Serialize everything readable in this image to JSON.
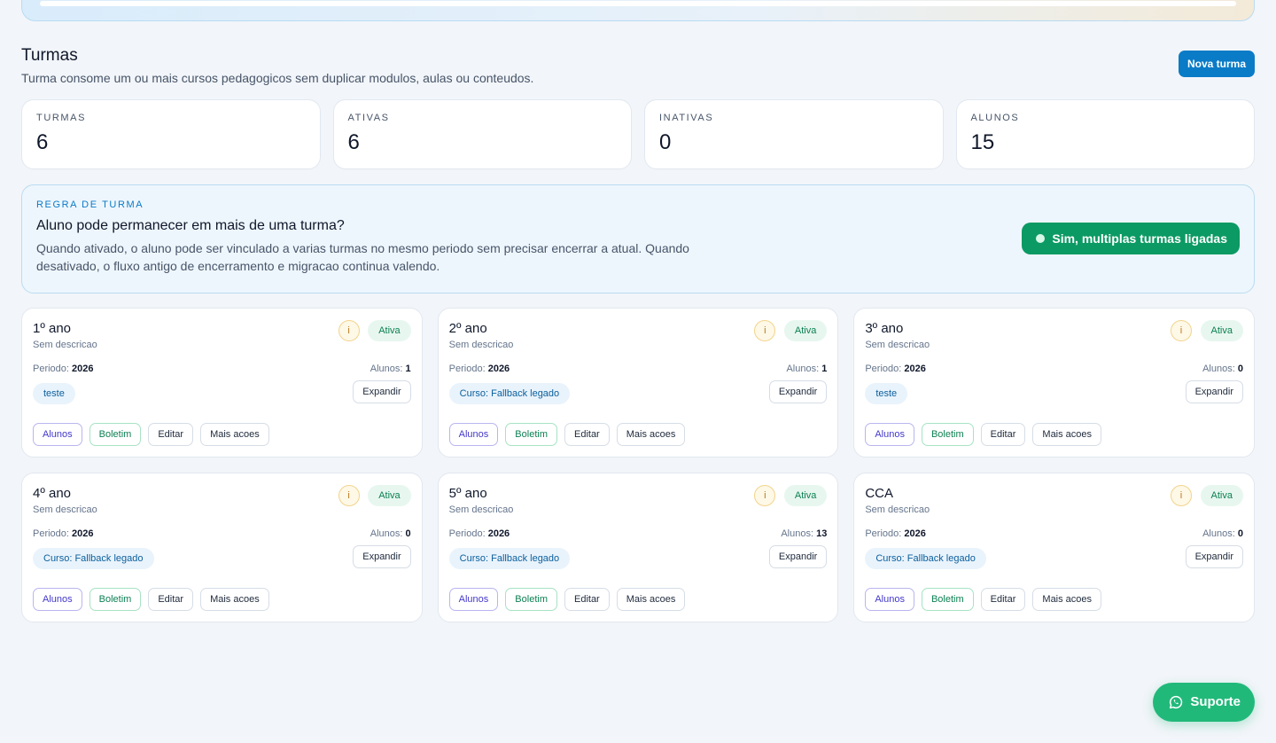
{
  "header": {
    "title": "Turmas",
    "subtitle": "Turma consome um ou mais cursos pedagogicos sem duplicar modulos, aulas ou conteudos.",
    "new_button": "Nova turma"
  },
  "stats": [
    {
      "label": "TURMAS",
      "value": "6"
    },
    {
      "label": "ATIVAS",
      "value": "6"
    },
    {
      "label": "INATIVAS",
      "value": "0"
    },
    {
      "label": "ALUNOS",
      "value": "15"
    }
  ],
  "rule": {
    "eyebrow": "REGRA DE TURMA",
    "title": "Aluno pode permanecer em mais de uma turma?",
    "description": "Quando ativado, o aluno pode ser vinculado a varias turmas no mesmo periodo sem precisar encerrar a atual. Quando desativado, o fluxo antigo de encerramento e migracao continua valendo.",
    "toggle_label": "Sim, multiplas turmas ligadas"
  },
  "labels": {
    "period": "Periodo:",
    "students": "Alunos:",
    "expand": "Expandir",
    "info": "i",
    "actions": {
      "alunos": "Alunos",
      "boletim": "Boletim",
      "editar": "Editar",
      "mais": "Mais acoes"
    }
  },
  "cards": [
    {
      "name": "1º ano",
      "description": "Sem descricao",
      "status": "Ativa",
      "period": "2026",
      "students": "1",
      "course": "teste"
    },
    {
      "name": "2º ano",
      "description": "Sem descricao",
      "status": "Ativa",
      "period": "2026",
      "students": "1",
      "course": "Curso: Fallback legado"
    },
    {
      "name": "3º ano",
      "description": "Sem descricao",
      "status": "Ativa",
      "period": "2026",
      "students": "0",
      "course": "teste"
    },
    {
      "name": "4º ano",
      "description": "Sem descricao",
      "status": "Ativa",
      "period": "2026",
      "students": "0",
      "course": "Curso: Fallback legado"
    },
    {
      "name": "5º ano",
      "description": "Sem descricao",
      "status": "Ativa",
      "period": "2026",
      "students": "13",
      "course": "Curso: Fallback legado"
    },
    {
      "name": "CCA",
      "description": "Sem descricao",
      "status": "Ativa",
      "period": "2026",
      "students": "0",
      "course": "Curso: Fallback legado"
    }
  ],
  "support": {
    "label": "Suporte",
    "icon": "whatsapp-icon"
  },
  "colors": {
    "primary": "#0a7bc7",
    "success": "#0b9a63",
    "support": "#21b97a"
  }
}
